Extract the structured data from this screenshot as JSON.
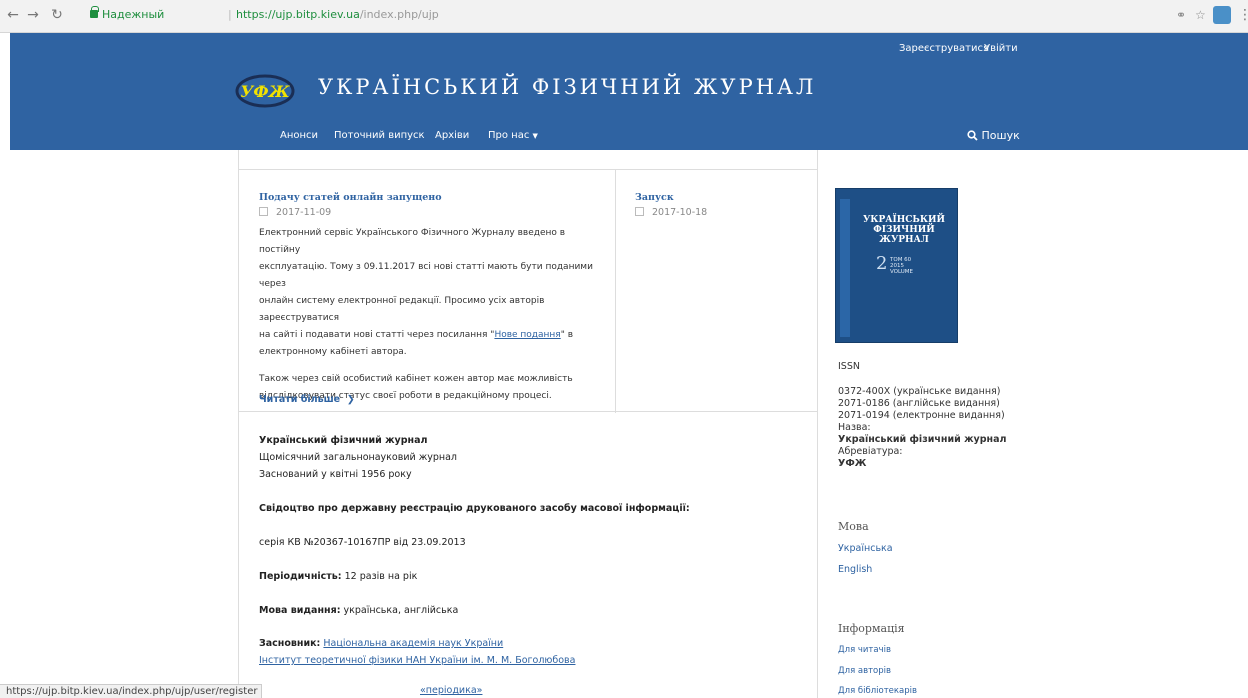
{
  "browser": {
    "secure_label": "Надежный",
    "separator": "|",
    "url_base": "https://ujp.bitp.kiev.ua",
    "url_path": "/index.php/ujp",
    "status_url": "https://ujp.bitp.kiev.ua/index.php/ujp/user/register"
  },
  "header": {
    "logo_text": "УФЖ",
    "title": "УКРАЇНСЬКИЙ ФІЗИЧНИЙ ЖУРНАЛ",
    "register": "Зареєструватися",
    "login": "Увійти",
    "nav": [
      "Анонси",
      "Поточний випуск",
      "Архіви",
      "Про нас"
    ],
    "search": "Пошук"
  },
  "announcements": [
    {
      "title": "Подачу статей онлайн запущено",
      "date": "2017-11-09",
      "body_lines": [
        "Електронний сервіс Українського Фізичного Журналу введено в постійну",
        "експлуатацію. Тому з 09.11.2017 всі нові статті мають бути поданими через",
        "онлайн систему електронної редакції. Просимо усіх авторів зареєструватися",
        "на сайті і подавати нові статті через посилання \"",
        "електронному кабінеті автора."
      ],
      "link_text": "Нове подання",
      "after_link": "\" в",
      "body2_lines": [
        "Також через свій особистий кабінет кожен автор має можливість",
        "відслідковувати статус своєї роботи в редакційному процесі."
      ],
      "read_more": "Читати більше"
    },
    {
      "title": "Запуск",
      "date": "2017-10-18"
    }
  ],
  "about": {
    "name": "Український фізичний журнал",
    "subtitle": "Щомісячний загальнонауковий журнал",
    "founded": "Заснований у квітні 1956 року",
    "certificate_label": "Свідоцтво про державну реєстрацію друкованого засобу масової інформації:",
    "certificate_value": "серія КВ №20367-10167ПР від 23.09.2013",
    "periodicity_label": "Періодичність:",
    "periodicity_value": " 12 разів на рік",
    "language_label": "Мова видання:",
    "language_value": " українська, англійська",
    "founder_label": "Засновник:",
    "founder_1": "Національна академія наук України",
    "founder_2": "Інститут теоретичної фізики НАН України ім. М. М. Боголюбова",
    "peek_text": "«періодика»"
  },
  "sidebar": {
    "cover": {
      "title": "УКРАЇНСЬКИЙ ФІЗИЧНИЙ ЖУРНАЛ",
      "number": "2",
      "volume": "ТОМ 60\n2015\nVOLUME"
    },
    "issn_label": "ISSN",
    "issn_lines": [
      "0372-400X (українське видання)",
      "2071-0186 (англійське видання)",
      "2071-0194 (електронне видання)"
    ],
    "name_label": "Назва:",
    "name_value": "Український фізичний журнал",
    "abbr_label": "Абревіатура:",
    "abbr_value": "УФЖ",
    "language_heading": "Мова",
    "languages": [
      "Українська",
      "English"
    ],
    "info_heading": "Інформація",
    "info_links": [
      "Для читачів",
      "Для авторів",
      "Для бібліотекарів"
    ]
  },
  "colors": {
    "header": "#2f63a2",
    "link": "#2f63a2",
    "secure": "#1e8e3e"
  }
}
